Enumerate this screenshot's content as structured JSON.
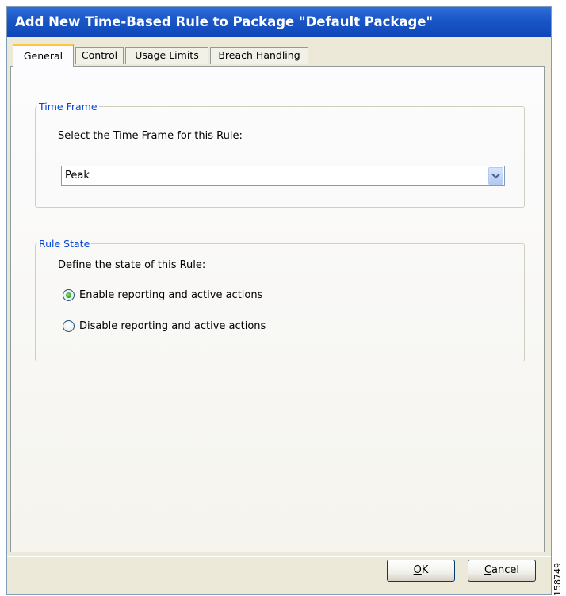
{
  "window": {
    "title": "Add New Time-Based Rule to Package \"Default Package\""
  },
  "tabs": [
    {
      "label": "General",
      "active": true
    },
    {
      "label": "Control",
      "active": false
    },
    {
      "label": "Usage Limits",
      "active": false
    },
    {
      "label": "Breach Handling",
      "active": false
    }
  ],
  "time_frame": {
    "legend": "Time Frame",
    "prompt": "Select the Time Frame for this Rule:",
    "selected": "Peak"
  },
  "rule_state": {
    "legend": "Rule State",
    "prompt": "Define the state of this Rule:",
    "options": [
      {
        "label": "Enable reporting and active actions",
        "checked": true
      },
      {
        "label": "Disable reporting and active actions",
        "checked": false
      }
    ]
  },
  "buttons": {
    "ok_mnemonic": "O",
    "ok_rest": "K",
    "cancel_mnemonic": "C",
    "cancel_rest": "ancel"
  },
  "figure_id": "158749",
  "colors": {
    "title_bar": "#1a55c6",
    "group_legend": "#0046d5",
    "active_tab_accent": "#ffc83c",
    "radio_selected": "#21a121"
  },
  "icons": {
    "dropdown": "chevron-down-icon",
    "radio_on": "radio-selected-icon",
    "radio_off": "radio-unselected-icon"
  }
}
